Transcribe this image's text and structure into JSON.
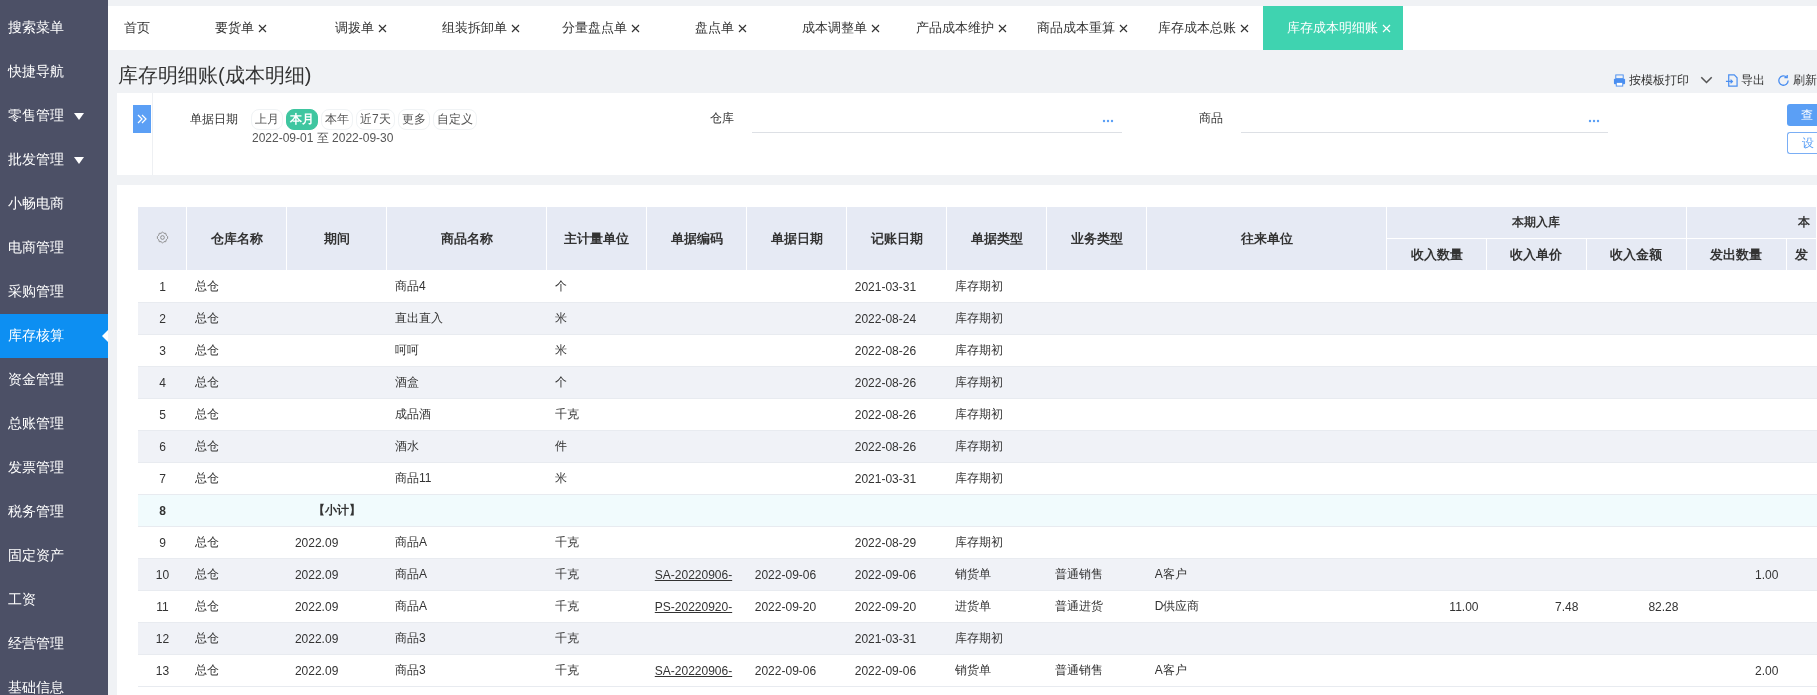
{
  "sidebar": {
    "items": [
      {
        "label": "搜索菜单",
        "expandable": false,
        "selected": false
      },
      {
        "label": "快捷导航",
        "expandable": false,
        "selected": false
      },
      {
        "label": "零售管理",
        "expandable": true,
        "selected": false
      },
      {
        "label": "批发管理",
        "expandable": true,
        "selected": false
      },
      {
        "label": "小畅电商",
        "expandable": false,
        "selected": false
      },
      {
        "label": "电商管理",
        "expandable": false,
        "selected": false
      },
      {
        "label": "采购管理",
        "expandable": false,
        "selected": false
      },
      {
        "label": "库存核算",
        "expandable": false,
        "selected": true
      },
      {
        "label": "资金管理",
        "expandable": false,
        "selected": false
      },
      {
        "label": "总账管理",
        "expandable": false,
        "selected": false
      },
      {
        "label": "发票管理",
        "expandable": false,
        "selected": false
      },
      {
        "label": "税务管理",
        "expandable": false,
        "selected": false
      },
      {
        "label": "固定资产",
        "expandable": false,
        "selected": false
      },
      {
        "label": "工资",
        "expandable": false,
        "selected": false
      },
      {
        "label": "经营管理",
        "expandable": false,
        "selected": false
      },
      {
        "label": "基础信息",
        "expandable": false,
        "selected": false
      }
    ]
  },
  "tabs": [
    {
      "label": "首页",
      "closable": false,
      "selected": false
    },
    {
      "label": "要货单",
      "closable": true,
      "selected": false
    },
    {
      "label": "调拨单",
      "closable": true,
      "selected": false
    },
    {
      "label": "组装拆卸单",
      "closable": true,
      "selected": false
    },
    {
      "label": "分量盘点单",
      "closable": true,
      "selected": false
    },
    {
      "label": "盘点单",
      "closable": true,
      "selected": false
    },
    {
      "label": "成本调整单",
      "closable": true,
      "selected": false
    },
    {
      "label": "产品成本维护",
      "closable": true,
      "selected": false
    },
    {
      "label": "商品成本重算",
      "closable": true,
      "selected": false
    },
    {
      "label": "库存成本总账",
      "closable": true,
      "selected": false
    },
    {
      "label": "库存成本明细账",
      "closable": true,
      "selected": true
    }
  ],
  "page_title": "库存明细账(成本明细)",
  "toolbar": [
    {
      "label": "按模板打印",
      "kind": "print"
    },
    {
      "label": "导出",
      "kind": "export"
    },
    {
      "label": "刷新",
      "kind": "refresh"
    }
  ],
  "filters": {
    "date": {
      "label": "单据日期",
      "chips": [
        {
          "label": "上月",
          "selected": false
        },
        {
          "label": "本月",
          "selected": true
        },
        {
          "label": "本年",
          "selected": false
        },
        {
          "label": "近7天",
          "selected": false
        },
        {
          "label": "更多",
          "selected": false
        },
        {
          "label": "自定义",
          "selected": false
        }
      ],
      "range": "2022-09-01 至 2022-09-30"
    },
    "warehouse": {
      "label": "仓库"
    },
    "product": {
      "label": "商品"
    },
    "buttons": [
      {
        "label": "查",
        "kind": "primary"
      },
      {
        "label": "设",
        "kind": "outline"
      }
    ]
  },
  "table": {
    "columns": [
      "仓库名称",
      "期间",
      "商品名称",
      "主计量单位",
      "单据编码",
      "单据日期",
      "记账日期",
      "单据类型",
      "业务类型",
      "往来单位"
    ],
    "groups": [
      {
        "label": "本期入库",
        "columns": [
          "收入数量",
          "收入单价",
          "收入金额"
        ]
      },
      {
        "label": "本",
        "columns": [
          "发出数量",
          "发"
        ]
      }
    ],
    "rows": [
      {
        "kind": "item",
        "index": "1",
        "warehouse": "总仓",
        "product": "商品4",
        "unit": "个",
        "post_date": "2021-03-31",
        "doc_type": "库存期初"
      },
      {
        "kind": "item",
        "index": "2",
        "warehouse": "总仓",
        "product": "直出直入",
        "unit": "米",
        "post_date": "2022-08-24",
        "doc_type": "库存期初"
      },
      {
        "kind": "item",
        "index": "3",
        "warehouse": "总仓",
        "product": "呵呵",
        "unit": "米",
        "post_date": "2022-08-26",
        "doc_type": "库存期初"
      },
      {
        "kind": "item",
        "index": "4",
        "warehouse": "总仓",
        "product": "酒盒",
        "unit": "个",
        "post_date": "2022-08-26",
        "doc_type": "库存期初"
      },
      {
        "kind": "item",
        "index": "5",
        "warehouse": "总仓",
        "product": "成品酒",
        "unit": "千克",
        "post_date": "2022-08-26",
        "doc_type": "库存期初"
      },
      {
        "kind": "item",
        "index": "6",
        "warehouse": "总仓",
        "product": "酒水",
        "unit": "件",
        "post_date": "2022-08-26",
        "doc_type": "库存期初"
      },
      {
        "kind": "item",
        "index": "7",
        "warehouse": "总仓",
        "product": "商品11",
        "unit": "米",
        "post_date": "2021-03-31",
        "doc_type": "库存期初"
      },
      {
        "kind": "subtotal",
        "index": "8",
        "period": "【小计】"
      },
      {
        "kind": "item",
        "index": "9",
        "warehouse": "总仓",
        "period": "2022.09",
        "product": "商品A",
        "unit": "千克",
        "post_date": "2022-08-29",
        "doc_type": "库存期初"
      },
      {
        "kind": "item",
        "index": "10",
        "warehouse": "总仓",
        "period": "2022.09",
        "product": "商品A",
        "unit": "千克",
        "doc_no": "SA-20220906-",
        "doc_date": "2022-09-06",
        "post_date": "2022-09-06",
        "doc_type": "销货单",
        "biz_type": "普通销售",
        "partner": "A客户",
        "out_qty": "1.00"
      },
      {
        "kind": "item",
        "index": "11",
        "warehouse": "总仓",
        "period": "2022.09",
        "product": "商品A",
        "unit": "千克",
        "doc_no": "PS-20220920-",
        "doc_date": "2022-09-20",
        "post_date": "2022-09-20",
        "doc_type": "进货单",
        "biz_type": "普通进货",
        "partner": "D供应商",
        "in_qty": "11.00",
        "in_price": "7.48",
        "in_amount": "82.28"
      },
      {
        "kind": "item",
        "index": "12",
        "warehouse": "总仓",
        "period": "2022.09",
        "product": "商品3",
        "unit": "千克",
        "post_date": "2021-03-31",
        "doc_type": "库存期初"
      },
      {
        "kind": "item",
        "index": "13",
        "warehouse": "总仓",
        "period": "2022.09",
        "product": "商品3",
        "unit": "千克",
        "doc_no": "SA-20220906-",
        "doc_date": "2022-09-06",
        "post_date": "2022-09-06",
        "doc_type": "销货单",
        "biz_type": "普通销售",
        "partner": "A客户",
        "out_qty": "2.00"
      }
    ]
  }
}
